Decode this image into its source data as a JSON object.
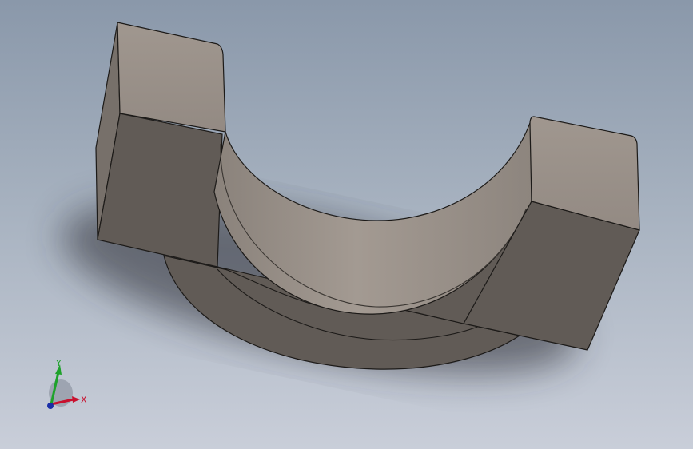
{
  "viewport": {
    "background_top": "#8a98aa",
    "background_bottom": "#c9ced9"
  },
  "model": {
    "top_face_color": "#9b928b",
    "side_face_color": "#625c57",
    "bore_face_color": "#9a918a",
    "edge_color": "#1c1a18"
  },
  "triad": {
    "x_label": "X",
    "y_label": "Y",
    "x_color": "#c8102e",
    "y_color": "#1ea22b",
    "z_color": "#1a2fa8"
  }
}
